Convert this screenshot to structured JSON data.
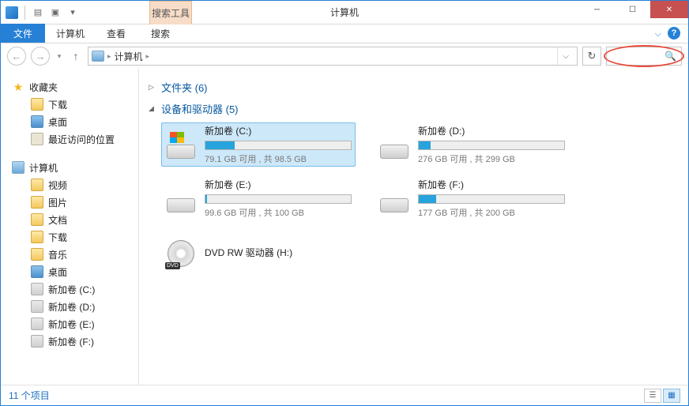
{
  "title_bar": {
    "search_tools_label": "搜索工具",
    "window_title": "计算机"
  },
  "ribbon": {
    "file": "文件",
    "tabs": [
      "计算机",
      "查看",
      "搜索"
    ]
  },
  "address_bar": {
    "location": "计算机"
  },
  "sidebar": {
    "favorites": {
      "label": "收藏夹",
      "items": [
        "下载",
        "桌面",
        "最近访问的位置"
      ]
    },
    "computer": {
      "label": "计算机",
      "items": [
        "视频",
        "图片",
        "文档",
        "下载",
        "音乐",
        "桌面",
        "新加卷 (C:)",
        "新加卷 (D:)",
        "新加卷 (E:)",
        "新加卷 (F:)"
      ]
    }
  },
  "content": {
    "folders_header": "文件夹 (6)",
    "devices_header": "设备和驱动器 (5)",
    "drives": [
      {
        "name": "新加卷 (C:)",
        "stats": "79.1 GB 可用 , 共 98.5 GB",
        "fill": 20,
        "selected": true,
        "os": true
      },
      {
        "name": "新加卷 (D:)",
        "stats": "276 GB 可用 , 共 299 GB",
        "fill": 8,
        "selected": false,
        "os": false
      },
      {
        "name": "新加卷 (E:)",
        "stats": "99.6 GB 可用 , 共 100 GB",
        "fill": 1,
        "selected": false,
        "os": false
      },
      {
        "name": "新加卷 (F:)",
        "stats": "177 GB 可用 , 共 200 GB",
        "fill": 12,
        "selected": false,
        "os": false
      }
    ],
    "dvd": {
      "name": "DVD RW 驱动器 (H:)"
    }
  },
  "status_bar": {
    "item_count": "11 个项目"
  }
}
